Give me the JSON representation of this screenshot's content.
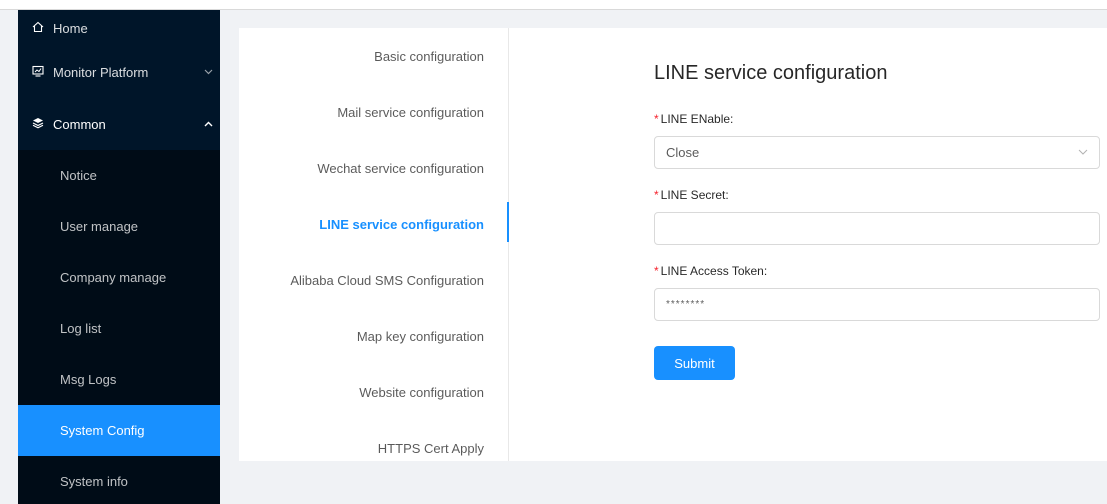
{
  "sidebar": {
    "top_items": [
      {
        "label": "Home",
        "icon": "home-icon"
      },
      {
        "label": "Monitor Platform",
        "icon": "monitor-icon"
      },
      {
        "label": "Common",
        "icon": "layers-icon"
      }
    ],
    "sub_items": [
      {
        "label": "Notice"
      },
      {
        "label": "User manage"
      },
      {
        "label": "Company manage"
      },
      {
        "label": "Log list"
      },
      {
        "label": "Msg Logs"
      },
      {
        "label": "System Config"
      },
      {
        "label": "System info"
      }
    ]
  },
  "config_menu": {
    "items": [
      {
        "label": "Basic configuration"
      },
      {
        "label": "Mail service configuration"
      },
      {
        "label": "Wechat service configuration"
      },
      {
        "label": "LINE service configuration"
      },
      {
        "label": "Alibaba Cloud SMS Configuration"
      },
      {
        "label": "Map key configuration"
      },
      {
        "label": "Website configuration"
      },
      {
        "label": "HTTPS Cert Apply"
      }
    ]
  },
  "form": {
    "title": "LINE service configuration",
    "required_mark": "*",
    "enable_label": "LINE ENable:",
    "enable_value": "Close",
    "secret_label": "LINE Secret:",
    "secret_value": "",
    "token_label": "LINE Access Token:",
    "token_value": "********",
    "submit_label": "Submit"
  },
  "colors": {
    "sidebar_bg": "#001529",
    "submenu_bg": "#000c17",
    "accent": "#1890ff",
    "required": "#f5222d"
  }
}
